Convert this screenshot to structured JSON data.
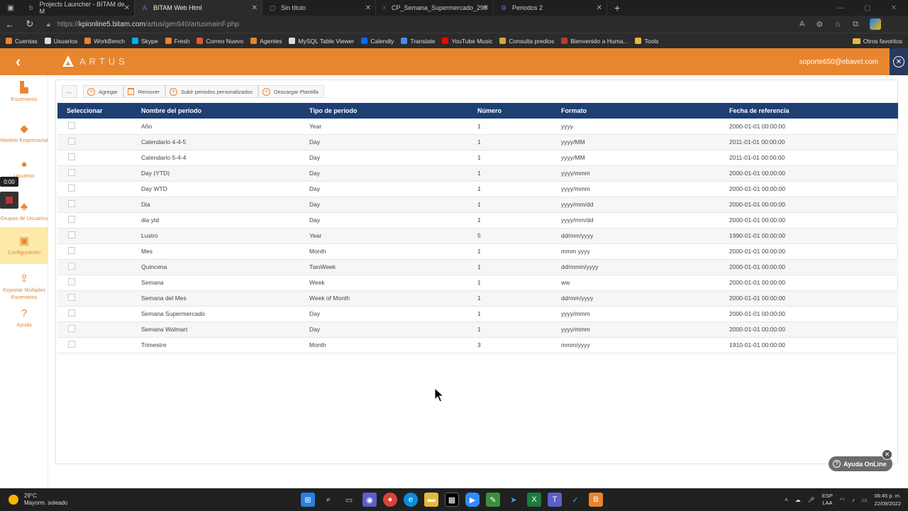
{
  "browser": {
    "tabs": [
      {
        "label": "Projects Launcher - BITAM de M",
        "icon": "b",
        "color": "#e8852f",
        "active": false
      },
      {
        "label": "BITAM Web Html",
        "icon": "A",
        "color": "#5b7fd6",
        "active": true
      },
      {
        "label": "Sin título",
        "icon": "▢",
        "color": "#888888",
        "active": false
      },
      {
        "label": "CP_Semana_Supermercado_290",
        "icon": "X",
        "color": "#1d7a3e",
        "active": false
      },
      {
        "label": "Periodos 2",
        "icon": "⚙",
        "color": "#6c6cd6",
        "active": false
      }
    ],
    "url_prefix": "https://",
    "url_host": "kpionline5.bitam.com",
    "url_path": "/artus/gen940/artusmainF.php",
    "bookmarks": [
      {
        "label": "Cuentas",
        "color": "#e8852f"
      },
      {
        "label": "Usuarios",
        "color": "#dddddd"
      },
      {
        "label": "WorkBench",
        "color": "#e8852f"
      },
      {
        "label": "Skype",
        "color": "#00aff0"
      },
      {
        "label": "Fresh",
        "color": "#e8852f"
      },
      {
        "label": "Correo Nuevo",
        "color": "#e05a2b"
      },
      {
        "label": "Agentes",
        "color": "#e8852f"
      },
      {
        "label": "MySQL Table Viewer",
        "color": "#dddddd"
      },
      {
        "label": "Calendly",
        "color": "#006bff"
      },
      {
        "label": "Translate",
        "color": "#4a8af4"
      },
      {
        "label": "YouTube Music",
        "color": "#ff0000"
      },
      {
        "label": "Consulta predios",
        "color": "#d6a83a"
      },
      {
        "label": "Bienvenido a Huma...",
        "color": "#c0392b"
      },
      {
        "label": "Tools",
        "color": "#e6b93d"
      }
    ],
    "other_favorites": "Otros favoritos"
  },
  "header": {
    "logo_text": "ARTUS",
    "user_email": "soporte650@ebavel.com"
  },
  "leftnav": [
    {
      "label": "Escenarios",
      "icon": "▙",
      "active": false
    },
    {
      "label": "Modelo Empresarial",
      "icon": "◆",
      "active": false
    },
    {
      "label": "Usuarios",
      "icon": "●",
      "active": false
    },
    {
      "label": "Grupos de Usuarios",
      "icon": "♣",
      "active": false
    },
    {
      "label": "Configuración",
      "icon": "▣",
      "active": true
    },
    {
      "label": "Exportar Múltiples Escenarios",
      "icon": "⇪",
      "active": false
    },
    {
      "label": "Ayuda",
      "icon": "?",
      "active": false
    }
  ],
  "recorder": {
    "time": "0:00"
  },
  "toolbar": {
    "add": "Agregar",
    "remove": "Remover",
    "upload": "Subir periodos personalizados",
    "download": "Descargar Plantilla"
  },
  "table": {
    "columns": [
      "Seleccionar",
      "Nombre del periodo",
      "Tipo de periodo",
      "Número",
      "Formato",
      "Fecha de referencia"
    ],
    "rows": [
      [
        "Año",
        "Year",
        "1",
        "yyyy",
        "2000-01-01 00:00:00"
      ],
      [
        "Calendario 4-4-5",
        "Day",
        "1",
        "yyyy/MM",
        "2011-01-01 00:00:00"
      ],
      [
        "Calendario 5-4-4",
        "Day",
        "1",
        "yyyy/MM",
        "2011-01-01 00:00:00"
      ],
      [
        "Day (YTD)",
        "Day",
        "1",
        "yyyy/mmm",
        "2000-01-01 00:00:00"
      ],
      [
        "Day WTD",
        "Day",
        "1",
        "yyyy/mmm",
        "2000-01-01 00:00:00"
      ],
      [
        "Dia",
        "Day",
        "1",
        "yyyy/mm/dd",
        "2000-01-01 00:00:00"
      ],
      [
        "dia ytd",
        "Day",
        "1",
        "yyyy/mm/dd",
        "2000-01-01 00:00:00"
      ],
      [
        "Lustro",
        "Year",
        "5",
        "dd/mm/yyyy",
        "1990-01-01 00:00:00"
      ],
      [
        "Mes",
        "Month",
        "1",
        "mmm yyyy",
        "2000-01-01 00:00:00"
      ],
      [
        "Quincena",
        "TwoWeek",
        "1",
        "dd/mmm/yyyy",
        "2000-01-01 00:00:00"
      ],
      [
        "Semana",
        "Week",
        "1",
        "ww",
        "2000-01-01 00:00:00"
      ],
      [
        "Semana del Mes",
        "Week of Month",
        "1",
        "dd/mm/yyyy",
        "2000-01-01 00:00:00"
      ],
      [
        "Semana Supermercado",
        "Day",
        "1",
        "yyyy/mmm",
        "2000-01-01 00:00:00"
      ],
      [
        "Semana Walmart",
        "Day",
        "1",
        "yyyy/mmm",
        "2000-01-01 00:00:00"
      ],
      [
        "Trimestre",
        "Month",
        "3",
        "mmm/yyyy",
        "1910-01-01 00:00:00"
      ]
    ]
  },
  "help": {
    "label": "Ayuda OnLine"
  },
  "taskbar": {
    "temp": "29°C",
    "weather": "Mayorm. soleado",
    "lang1": "ESP",
    "lang2": "LAA",
    "time": "06:45 p. m.",
    "date": "22/09/2022"
  }
}
